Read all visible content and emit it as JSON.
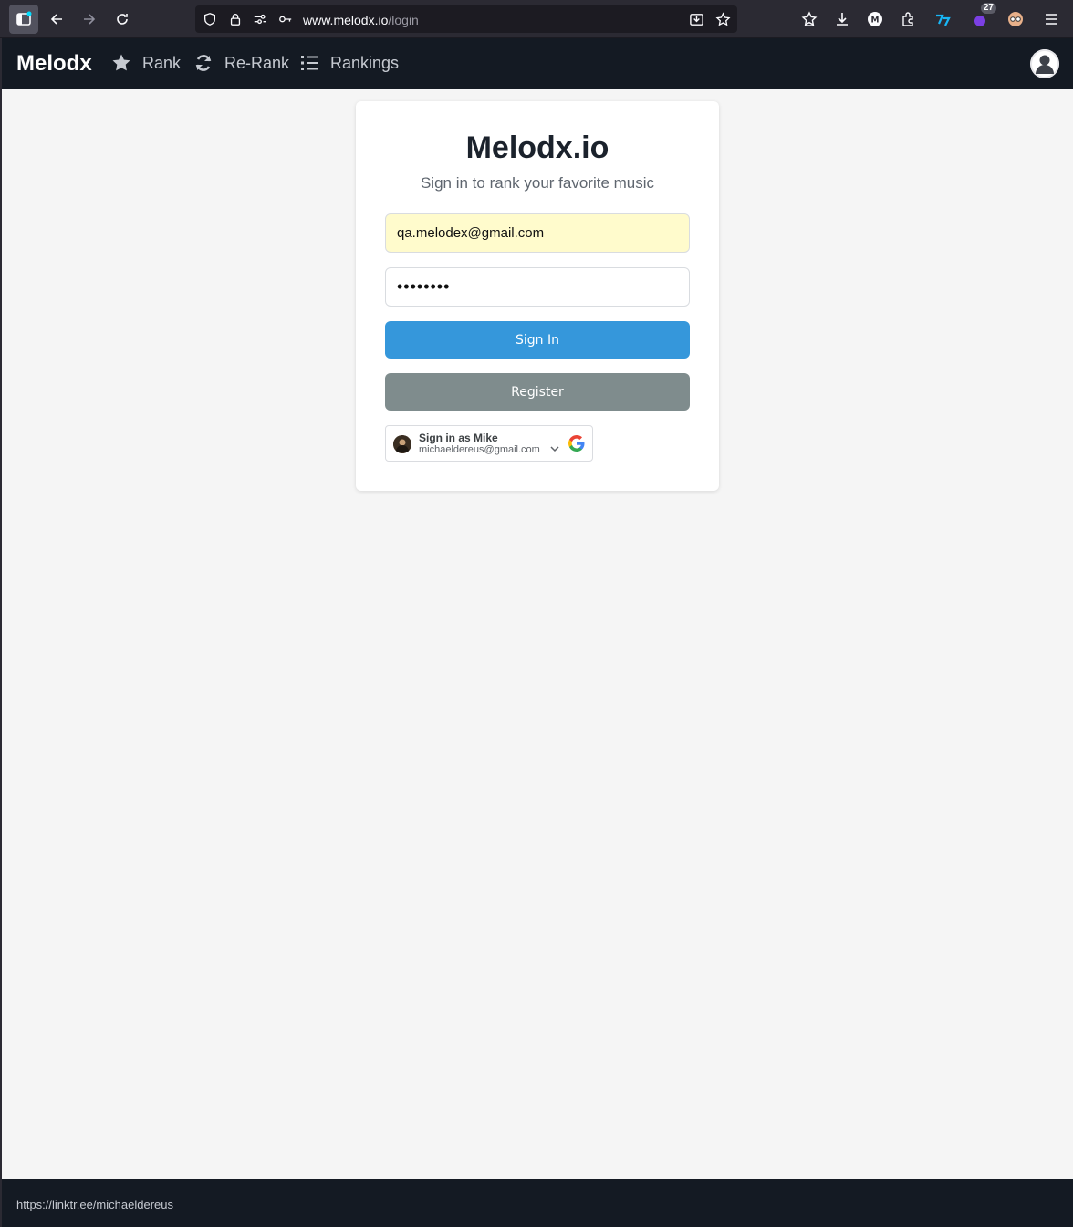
{
  "browser": {
    "url_host": "www.melodx.io",
    "url_path": "/login",
    "extension_badge": "27"
  },
  "navbar": {
    "brand": "Melodx",
    "items": [
      {
        "label": "Rank",
        "icon": "star-icon"
      },
      {
        "label": "Re-Rank",
        "icon": "refresh-icon"
      },
      {
        "label": "Rankings",
        "icon": "list-icon"
      }
    ]
  },
  "login": {
    "title": "Melodx.io",
    "subtitle": "Sign in to rank your favorite music",
    "email_value": "qa.melodex@gmail.com",
    "password_value": "••••••••",
    "signin_label": "Sign In",
    "register_label": "Register",
    "google": {
      "name_label": "Sign in as Mike",
      "email": "michaeldereus@gmail.com"
    }
  },
  "status_bar": {
    "link": "https://linktr.ee/michaeldereus"
  },
  "colors": {
    "navbar_bg": "#141a23",
    "signin_bg": "#3597db",
    "register_bg": "#7f8c8d",
    "page_bg": "#f5f5f5"
  }
}
